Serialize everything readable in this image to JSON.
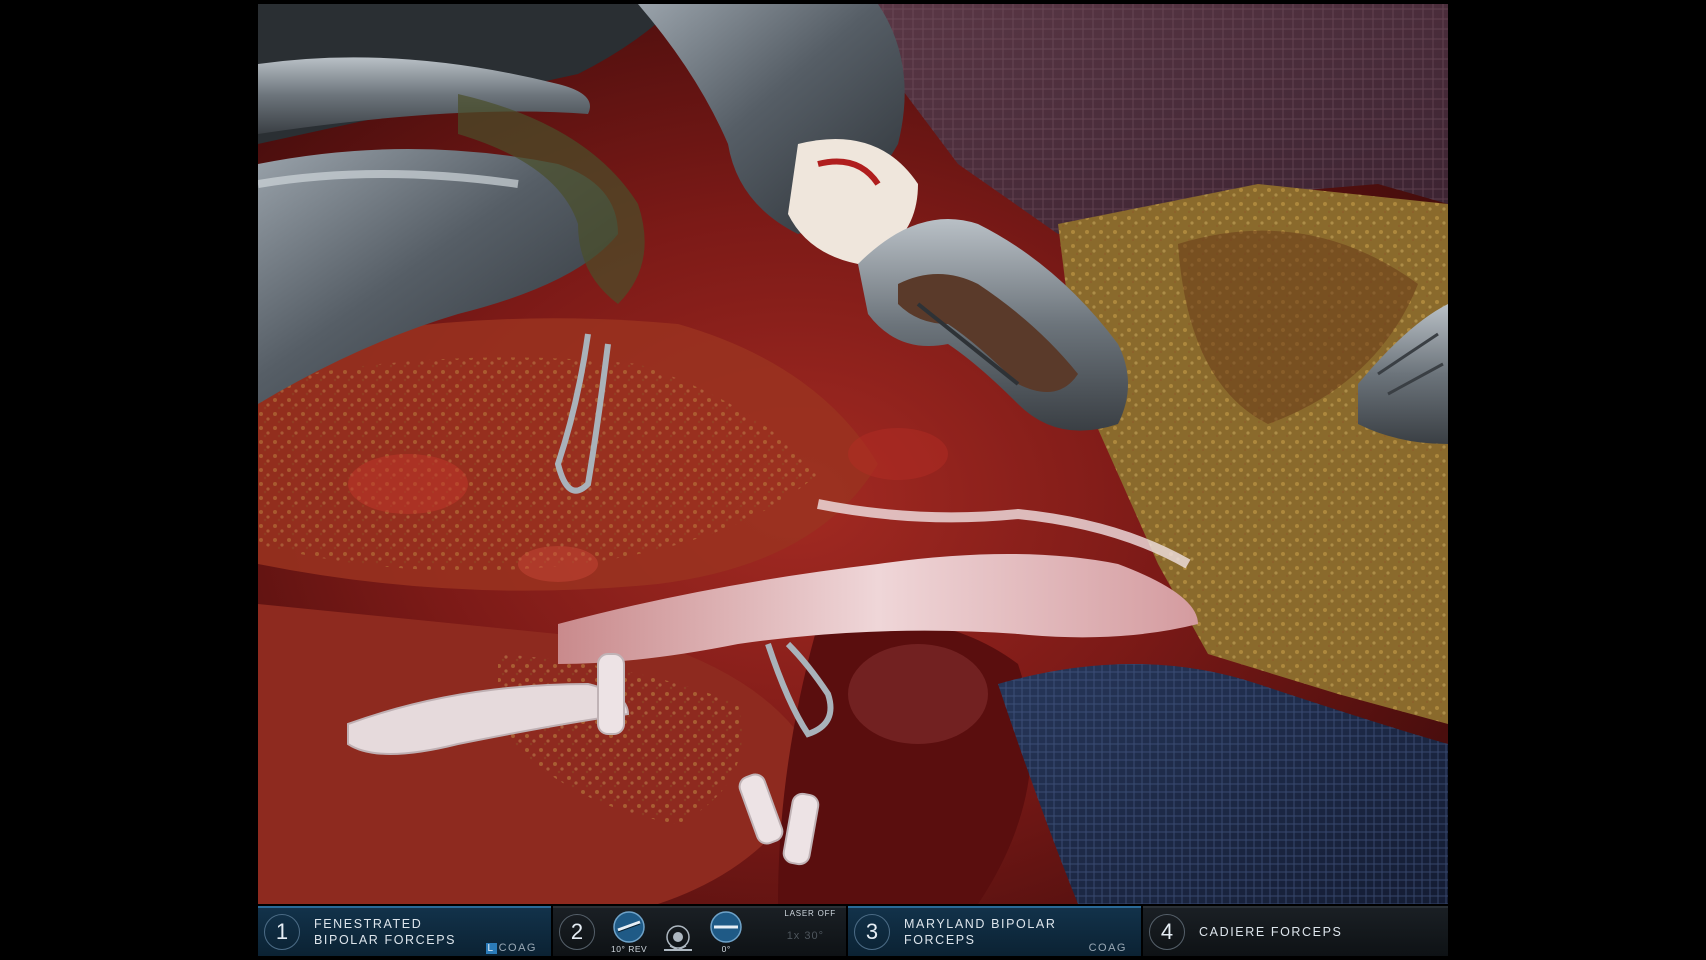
{
  "instruments": [
    {
      "arm": "1",
      "name": "FENESTRATED\nBIPOLAR FORCEPS",
      "side": "L",
      "mode": "COAG",
      "active": true
    },
    {
      "arm": "2",
      "scope": true,
      "scope_items": [
        {
          "icon": "scope-rev-icon",
          "label": "10° REV"
        },
        {
          "icon": "camera-orientation-icon",
          "label": ""
        },
        {
          "icon": "scope-angle-icon",
          "label": "0°"
        }
      ],
      "zoom": "1x 30°",
      "laser": "LASER OFF"
    },
    {
      "arm": "3",
      "name": "MARYLAND BIPOLAR\nFORCEPS",
      "side": "",
      "mode": "COAG",
      "active": true
    },
    {
      "arm": "4",
      "name": "CADIERE FORCEPS",
      "side": "",
      "mode": "",
      "active": false
    }
  ],
  "colors": {
    "active_panel": "#12324a",
    "inactive_panel": "#1a1f24",
    "accent_blue": "#2b7bb8"
  }
}
